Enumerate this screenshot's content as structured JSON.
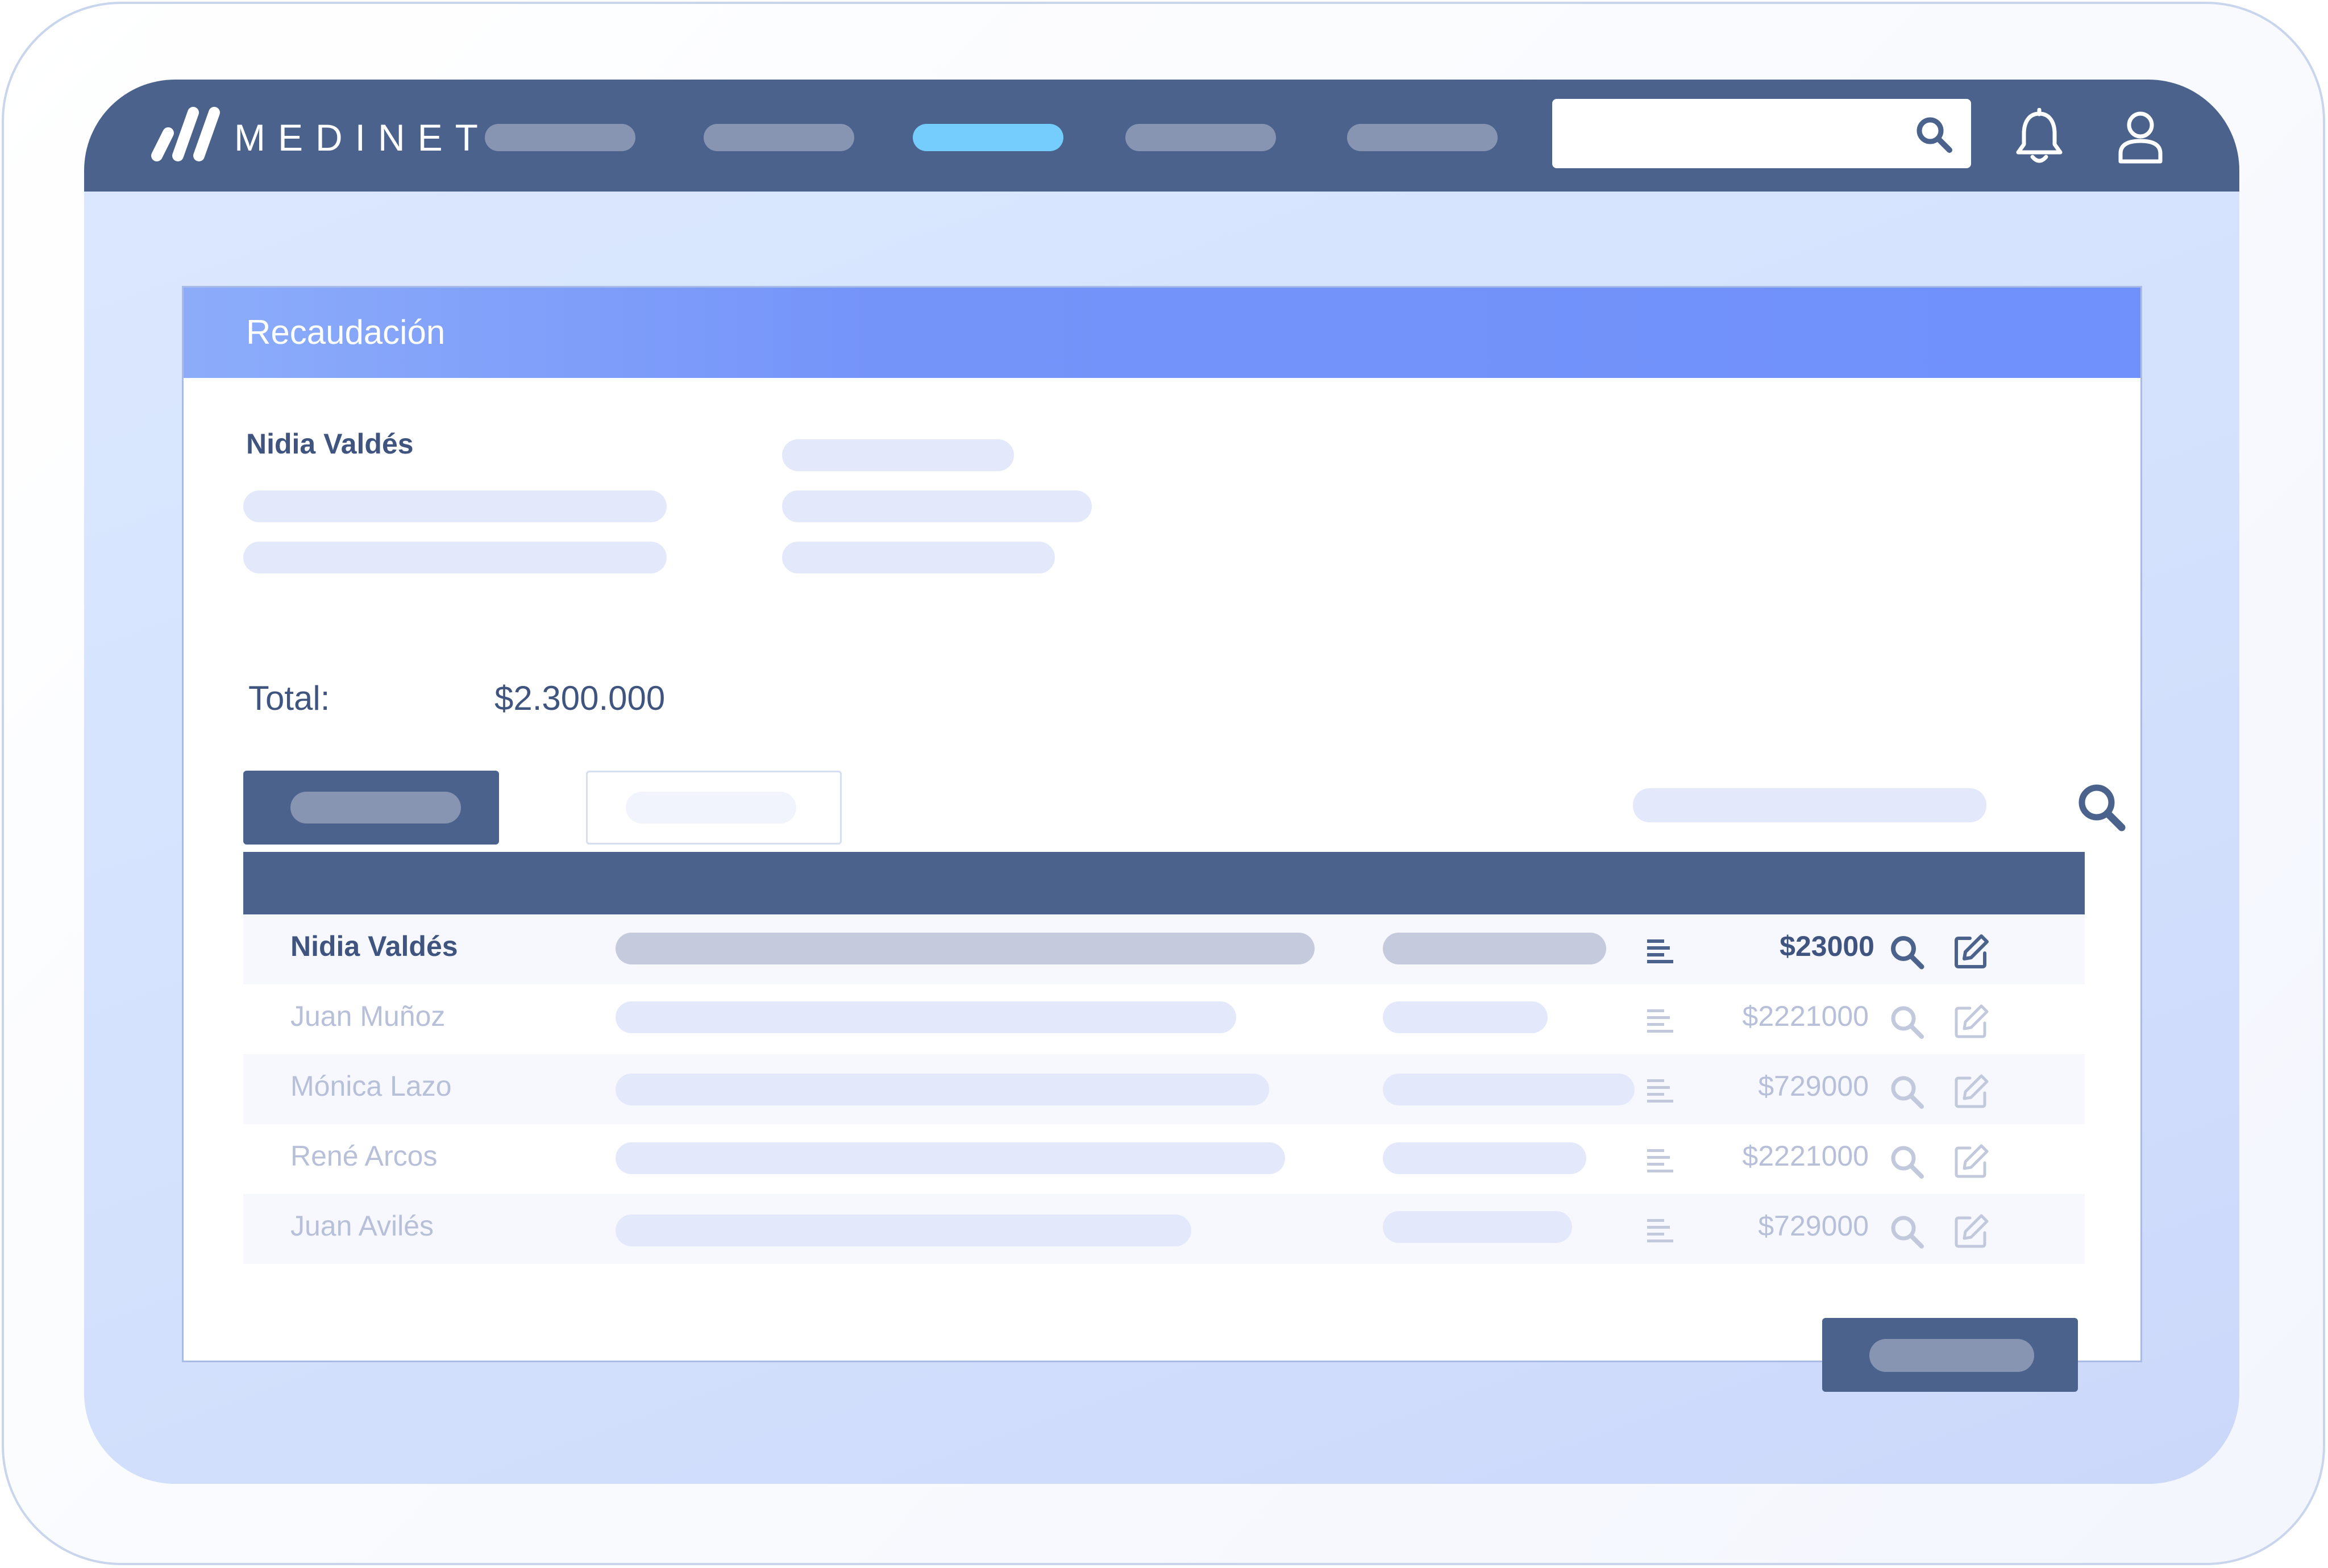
{
  "brand": {
    "name": "MEDINET",
    "logo_icon": "slashes-logo-icon"
  },
  "topbar": {
    "nav_items": [
      {
        "active": false
      },
      {
        "active": false
      },
      {
        "active": true
      },
      {
        "active": false
      },
      {
        "active": false
      }
    ],
    "search": {
      "placeholder": "",
      "icon": "search-icon"
    },
    "notifications_icon": "bell-icon",
    "profile_icon": "user-icon"
  },
  "card": {
    "title": "Recaudación",
    "patient_name": "Nidia Valdés",
    "total_label": "Total:",
    "total_value": "$2.300.000"
  },
  "table": {
    "rows": [
      {
        "name": "Nidia Valdés",
        "amount": "$23000",
        "highlighted": true
      },
      {
        "name": "Juan Muñoz",
        "amount": "$2221000",
        "highlighted": false
      },
      {
        "name": "Mónica Lazo",
        "amount": "$729000",
        "highlighted": false
      },
      {
        "name": "René Arcos",
        "amount": "$2221000",
        "highlighted": false
      },
      {
        "name": "Juan Avilés",
        "amount": "$729000",
        "highlighted": false
      }
    ],
    "row_icons": [
      "lines-icon",
      "zoom-icon",
      "edit-icon"
    ]
  },
  "colors": {
    "navy": "#4b638c",
    "header_blue": "#7090fb",
    "nav_active": "#74cdfd",
    "placeholder": "#e3e9fb",
    "background": "#d6e4fe"
  }
}
